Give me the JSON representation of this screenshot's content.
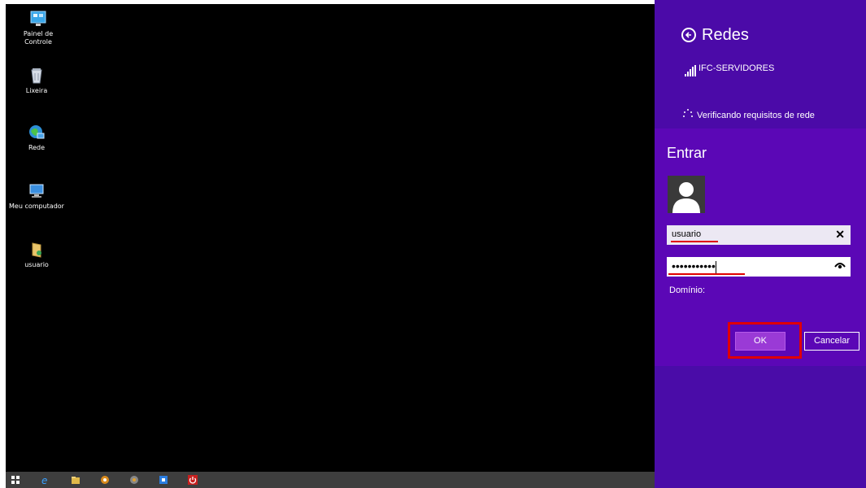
{
  "desktop": {
    "icons": [
      {
        "label": "Painel de Controle",
        "icon": "control-panel-icon"
      },
      {
        "label": "Lixeira",
        "icon": "recycle-bin-icon"
      },
      {
        "label": "Rede",
        "icon": "network-icon"
      },
      {
        "label": "Meu computador",
        "icon": "computer-icon"
      },
      {
        "label": "usuario",
        "icon": "user-folder-icon"
      }
    ]
  },
  "taskbar": {
    "items": [
      "start-icon",
      "internet-explorer-icon",
      "file-explorer-icon",
      "app-icon",
      "media-icon",
      "store-icon",
      "power-icon"
    ]
  },
  "panel": {
    "title": "Redes",
    "network_name": "IFC-SERVIDORES",
    "status": "Verificando requisitos de rede",
    "dialog": {
      "heading": "Entrar",
      "username_value": "usuario",
      "password_value": "•••••••••••",
      "domain_label": "Domínio:",
      "ok_label": "OK",
      "cancel_label": "Cancelar"
    }
  },
  "colors": {
    "panel_bg": "#4b0aa8",
    "dialog_bg": "#5b07b6",
    "ok_bg": "#9a3ad6",
    "annotation_red": "#e00000"
  }
}
